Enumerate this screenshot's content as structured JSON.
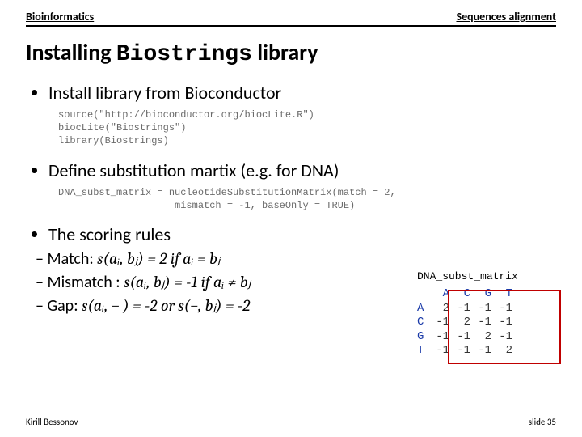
{
  "header": {
    "left": "Bioinformatics",
    "right": "Sequences alignment"
  },
  "title": {
    "pre": "Installing ",
    "mono": "Biostrings",
    "post": " library"
  },
  "bullets": {
    "b1": "Install library from Bioconductor",
    "code1": "source(\"http://bioconductor.org/biocLite.R\")\nbiocLite(\"Biostrings\")\nlibrary(Biostrings)",
    "b2": "Define substitution martix (e.g. for DNA)",
    "code2": "DNA_subst_matrix = nucleotideSubstitutionMatrix(match = 2,\n                    mismatch = -1, baseOnly = TRUE)",
    "b3": "The scoring rules",
    "r1_pre": "Match: ",
    "r1_eq": "s(aᵢ, bⱼ) = 2  if  aᵢ = bⱼ",
    "r2_pre": "Mismatch : ",
    "r2_eq": "s(aᵢ, bⱼ) = -1  if  aᵢ ≠ bⱼ",
    "r3_pre": "Gap: ",
    "r3_eq": "s(aᵢ, − ) = -2 or s(−, bⱼ) = -2"
  },
  "matrix": {
    "label": "DNA_subst_matrix",
    "headers": [
      "A",
      "C",
      "G",
      "T"
    ],
    "rows": [
      {
        "h": "A",
        "v": [
          "2",
          "-1",
          "-1",
          "-1"
        ]
      },
      {
        "h": "C",
        "v": [
          "-1",
          "2",
          "-1",
          "-1"
        ]
      },
      {
        "h": "G",
        "v": [
          "-1",
          "-1",
          "2",
          "-1"
        ]
      },
      {
        "h": "T",
        "v": [
          "-1",
          "-1",
          "-1",
          "2"
        ]
      }
    ]
  },
  "footer": {
    "author": "Kirill Bessonov",
    "slide": "slide 35"
  }
}
